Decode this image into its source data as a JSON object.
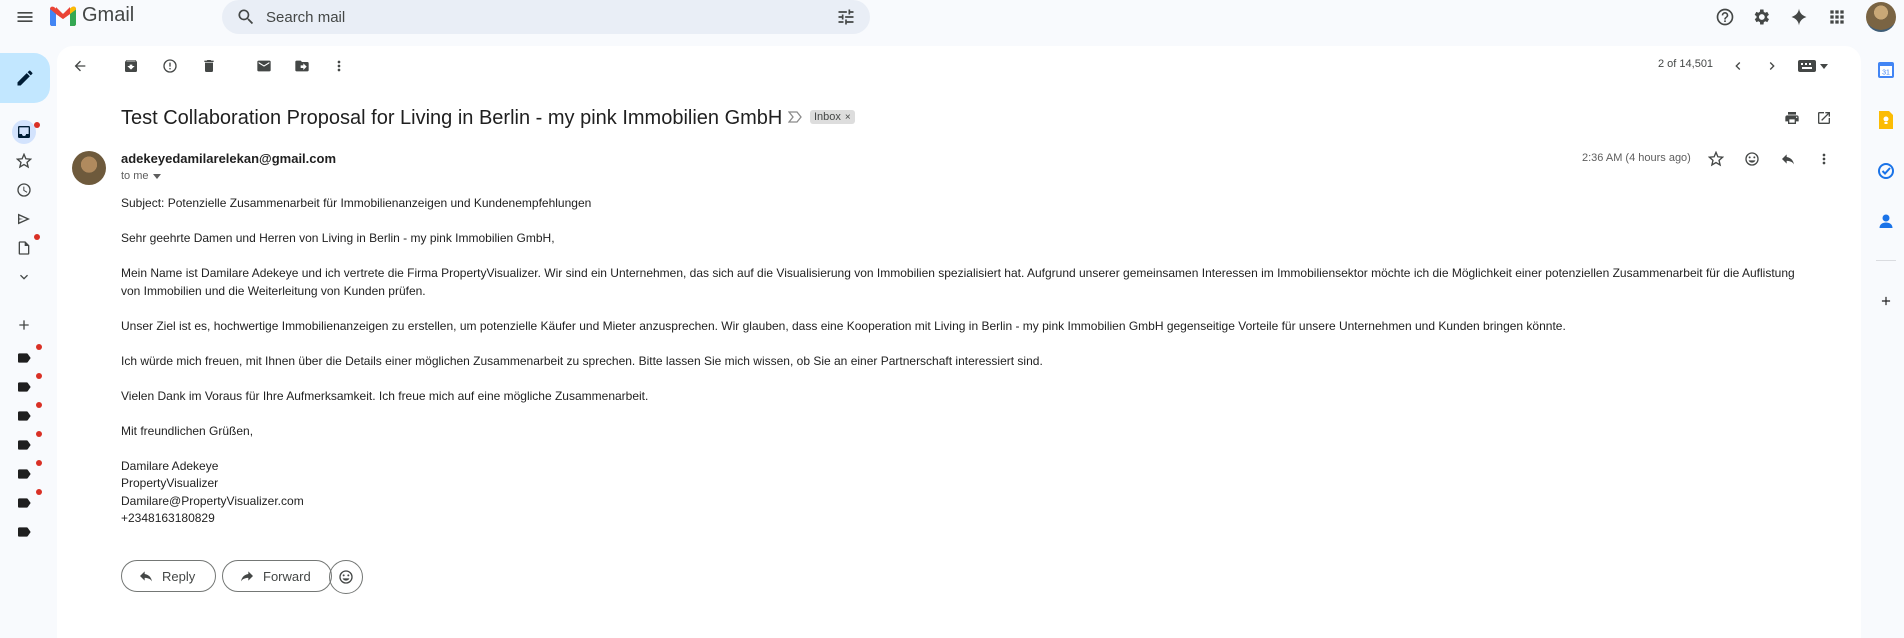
{
  "app": {
    "name": "Gmail"
  },
  "search": {
    "placeholder": "Search mail"
  },
  "pager": {
    "text": "2 of 14,501"
  },
  "email": {
    "subject": "Test Collaboration Proposal for Living in Berlin - my pink Immobilien GmbH",
    "label_chip": "Inbox",
    "sender": "adekeyedamilarelekan@gmail.com",
    "to": "to me",
    "timestamp": "2:36 AM (4 hours ago)",
    "body": [
      "Subject: Potenzielle Zusammenarbeit für Immobilienanzeigen und Kundenempfehlungen",
      "Sehr geehrte Damen und Herren von Living in Berlin - my pink Immobilien GmbH,",
      "Mein Name ist Damilare Adekeye und ich vertrete die Firma PropertyVisualizer. Wir sind ein Unternehmen, das sich auf die Visualisierung von Immobilien spezialisiert hat. Aufgrund unserer gemeinsamen Interessen im Immobiliensektor möchte ich die Möglichkeit einer potenziellen Zusammenarbeit für die Auflistung von Immobilien und die Weiterleitung von Kunden prüfen.",
      "Unser Ziel ist es, hochwertige Immobilienanzeigen zu erstellen, um potenzielle Käufer und Mieter anzusprechen. Wir glauben, dass eine Kooperation mit Living in Berlin - my pink Immobilien GmbH gegenseitige Vorteile für unsere Unternehmen und Kunden bringen könnte.",
      "Ich würde mich freuen, mit Ihnen über die Details einer möglichen Zusammenarbeit zu sprechen. Bitte lassen Sie mich wissen, ob Sie an einer Partnerschaft interessiert sind.",
      "Vielen Dank im Voraus für Ihre Aufmerksamkeit. Ich freue mich auf eine mögliche Zusammenarbeit.",
      "Mit freundlichen Grüßen,"
    ],
    "signature": [
      "Damilare Adekeye",
      "PropertyVisualizer",
      "Damilare@PropertyVisualizer.com",
      "+2348163180829"
    ]
  },
  "actions": {
    "reply": "Reply",
    "forward": "Forward"
  },
  "colors": {
    "brand_red": "#ea4335",
    "compose_bg": "#c2e7ff",
    "notification_dot": "#d93025"
  }
}
